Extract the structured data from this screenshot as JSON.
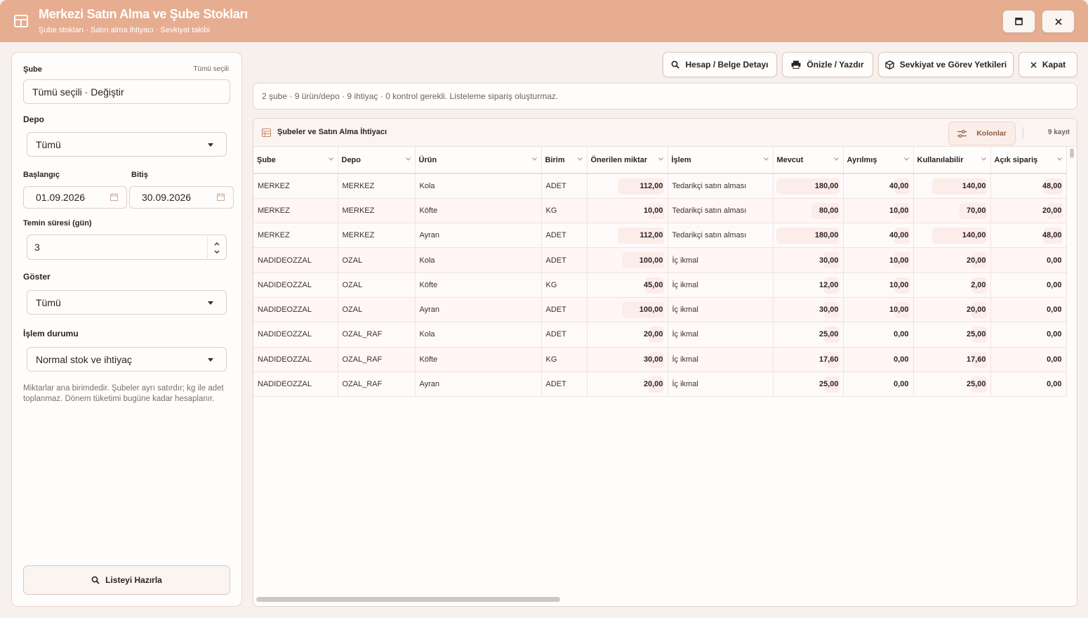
{
  "window": {
    "title": "Merkezi Satın Alma ve Şube Stokları",
    "subtitle": "Şube stokları · Satın alma ihtiyacı · Sevkiyat takibi"
  },
  "filters": {
    "branch_label": "Şube",
    "branch_hint": "Tümü seçili",
    "branch_value": "Tümü seçili · Değiştir",
    "warehouse_label": "Depo",
    "warehouse_value": "Tümü",
    "start_label": "Başlangıç",
    "start_value": "01.09.2026",
    "end_label": "Bitiş",
    "end_value": "30.09.2026",
    "lead_label": "Temin süresi (gün)",
    "lead_value": "3",
    "show_label": "Göster",
    "show_value": "Tümü",
    "status_label": "İşlem durumu",
    "status_value": "Normal stok ve ihtiyaç",
    "note": "Miktarlar ana birimdedir. Şubeler ayrı satırdır; kg ile adet toplanmaz. Dönem tüketimi bugüne kadar hesaplanır.",
    "prepare_label": "Listeyi Hazırla"
  },
  "toolbar": {
    "detail_label": "Hesap / Belge Detayı",
    "print_label": "Önizle / Yazdır",
    "permissions_label": "Sevkiyat ve Görev Yetkileri",
    "close_label": "Kapat"
  },
  "info_text": "2 şube · 9 ürün/depo · 9 ihtiyaç · 0 kontrol gerekli. Listeleme sipariş oluşturmaz.",
  "grid": {
    "title": "Şubeler ve Satın Alma İhtiyacı",
    "columns_label": "Kolonlar",
    "count": "9 kayıt",
    "headers": [
      "Şube",
      "Depo",
      "Ürün",
      "Birim",
      "Önerilen miktar",
      "İşlem",
      "Mevcut",
      "Ayrılmış",
      "Kullanılabilir",
      "Açık sipariş"
    ],
    "rows": [
      [
        "MERKEZ",
        "MERKEZ",
        "Kola",
        "ADET",
        "112,00",
        "Tedarikçi satın alması",
        "180,00",
        "40,00",
        "140,00",
        "48,00"
      ],
      [
        "MERKEZ",
        "MERKEZ",
        "Köfte",
        "KG",
        "10,00",
        "Tedarikçi satın alması",
        "80,00",
        "10,00",
        "70,00",
        "20,00"
      ],
      [
        "MERKEZ",
        "MERKEZ",
        "Ayran",
        "ADET",
        "112,00",
        "Tedarikçi satın alması",
        "180,00",
        "40,00",
        "140,00",
        "48,00"
      ],
      [
        "NADIDEOZZAL",
        "OZAL",
        "Kola",
        "ADET",
        "100,00",
        "İç ikmal",
        "30,00",
        "10,00",
        "20,00",
        "0,00"
      ],
      [
        "NADIDEOZZAL",
        "OZAL",
        "Köfte",
        "KG",
        "45,00",
        "İç ikmal",
        "12,00",
        "10,00",
        "2,00",
        "0,00"
      ],
      [
        "NADIDEOZZAL",
        "OZAL",
        "Ayran",
        "ADET",
        "100,00",
        "İç ikmal",
        "30,00",
        "10,00",
        "20,00",
        "0,00"
      ],
      [
        "NADIDEOZZAL",
        "OZAL_RAF",
        "Kola",
        "ADET",
        "20,00",
        "İç ikmal",
        "25,00",
        "0,00",
        "25,00",
        "0,00"
      ],
      [
        "NADIDEOZZAL",
        "OZAL_RAF",
        "Köfte",
        "KG",
        "30,00",
        "İç ikmal",
        "17,60",
        "0,00",
        "17,60",
        "0,00"
      ],
      [
        "NADIDEOZZAL",
        "OZAL_RAF",
        "Ayran",
        "ADET",
        "20,00",
        "İç ikmal",
        "25,00",
        "0,00",
        "25,00",
        "0,00"
      ]
    ]
  },
  "colors": {
    "titlebar": "#e7ad91",
    "accent_text": "#8e5a43",
    "cell_bar": "#fcecea"
  }
}
